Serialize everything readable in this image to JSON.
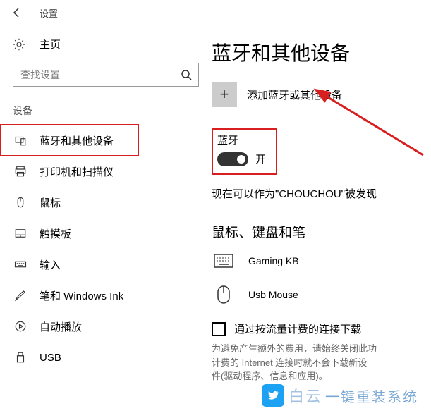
{
  "titlebar": {
    "app_name": "设置"
  },
  "sidebar": {
    "home_label": "主页",
    "search_placeholder": "查找设置",
    "section_header": "设备",
    "items": [
      {
        "label": "蓝牙和其他设备"
      },
      {
        "label": "打印机和扫描仪"
      },
      {
        "label": "鼠标"
      },
      {
        "label": "触摸板"
      },
      {
        "label": "输入"
      },
      {
        "label": "笔和 Windows Ink"
      },
      {
        "label": "自动播放"
      },
      {
        "label": "USB"
      }
    ]
  },
  "main": {
    "page_title": "蓝牙和其他设备",
    "add_device_label": "添加蓝牙或其他设备",
    "bluetooth": {
      "label": "蓝牙",
      "state": "开"
    },
    "discoverable_text": "现在可以作为\"CHOUCHOU\"被发现",
    "peripherals_title": "鼠标、键盘和笔",
    "devices": [
      {
        "name": "Gaming KB"
      },
      {
        "name": "Usb Mouse"
      }
    ],
    "metered": {
      "label": "通过按流量计费的连接下载",
      "desc_line1": "为避免产生额外的费用，请始终关闭此功",
      "desc_line2": "计费的 Internet 连接时就不会下载新设",
      "desc_line3": "件(驱动程序、信息和应用)。"
    }
  },
  "watermark": {
    "text1": "白云",
    "text2": "一键重装系统"
  }
}
